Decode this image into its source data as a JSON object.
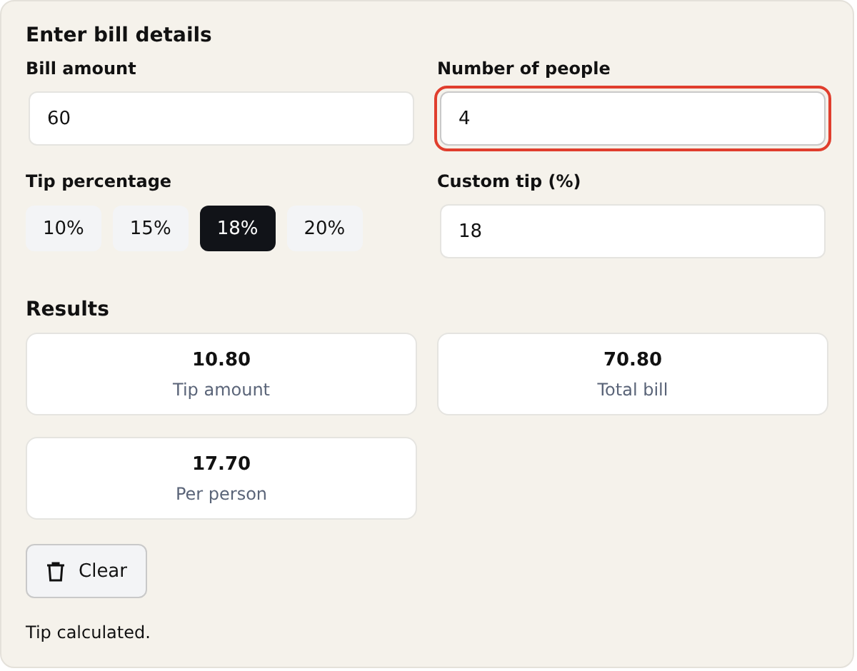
{
  "title": "Enter bill details",
  "fields": [
    {
      "label": "Bill amount",
      "value": "60",
      "focused": false
    },
    {
      "label": "Number of people",
      "value": "4",
      "focused": true
    }
  ],
  "tip": {
    "label": "Tip percentage",
    "options": [
      {
        "label": "10%",
        "selected": false
      },
      {
        "label": "15%",
        "selected": false
      },
      {
        "label": "18%",
        "selected": true
      },
      {
        "label": "20%",
        "selected": false
      }
    ]
  },
  "custom_tip": {
    "label": "Custom tip (%)",
    "value": "18",
    "focused": false
  },
  "results": {
    "title": "Results",
    "cards": [
      {
        "value": "10.80",
        "label": "Tip amount"
      },
      {
        "value": "70.80",
        "label": "Total bill"
      },
      {
        "value": "17.70",
        "label": "Per person"
      }
    ]
  },
  "clear_button": "Clear",
  "status": "Tip calculated."
}
